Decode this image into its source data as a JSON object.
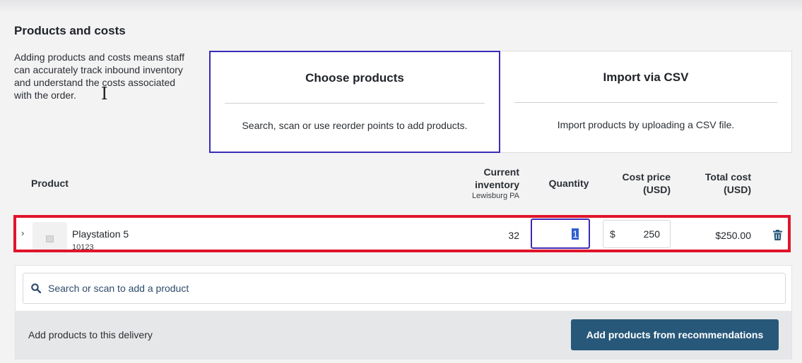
{
  "section": {
    "title": "Products and costs",
    "description": "Adding products and costs means staff can accurately track inbound inventory and understand the costs associated with the order."
  },
  "options": [
    {
      "title": "Choose products",
      "description": "Search, scan or use reorder points to add products.",
      "selected": true
    },
    {
      "title": "Import via CSV",
      "description": "Import products by uploading a CSV file.",
      "selected": false
    }
  ],
  "table": {
    "headers": {
      "product": "Product",
      "inventory": "Current inventory",
      "inventory_location": "Lewisburg PA",
      "quantity": "Quantity",
      "cost_price": "Cost price (USD)",
      "total_cost": "Total cost (USD)"
    },
    "rows": [
      {
        "name": "Playstation 5",
        "sku": "10123",
        "inventory": "32",
        "quantity": "1",
        "currency_symbol": "$",
        "cost_price": "250",
        "total_cost": "$250.00"
      }
    ]
  },
  "search": {
    "placeholder": "Search or scan to add a product"
  },
  "footer": {
    "text": "Add products to this delivery",
    "button_label": "Add products from recommendations"
  },
  "colors": {
    "accent": "#3a2bb6",
    "button": "#27587a",
    "highlight": "#e0152b",
    "trash": "#27587a"
  },
  "icons": [
    "chevron-right-icon",
    "image-placeholder-icon",
    "trash-icon",
    "search-icon",
    "text-cursor-icon"
  ]
}
